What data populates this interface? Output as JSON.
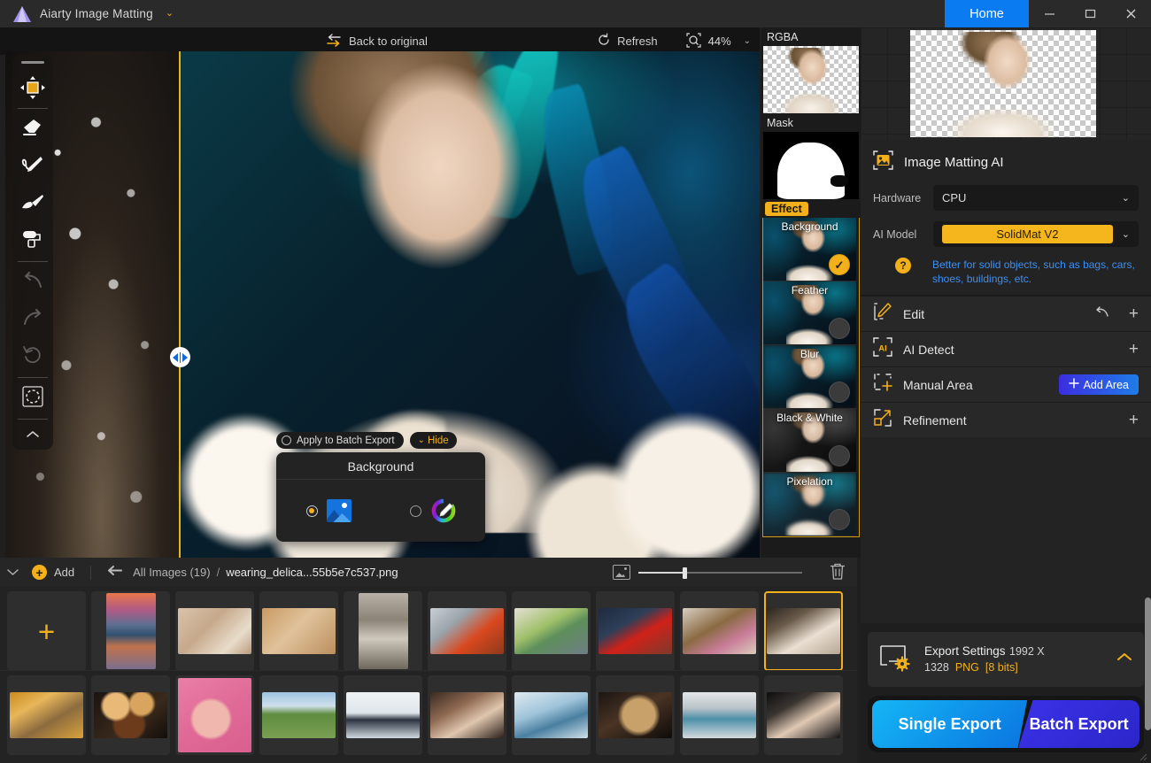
{
  "titlebar": {
    "app_name": "Aiarty Image Matting",
    "dropdown_caret": "⌄",
    "home_label": "Home",
    "minimize": "—",
    "maximize": "▢",
    "close": "✕"
  },
  "canvas_toolbar": {
    "back_to_original": "Back to original",
    "refresh": "Refresh",
    "zoom_level": "44%",
    "zoom_caret": "⌄"
  },
  "left_tools": [
    {
      "name": "move-tool",
      "label": "Move",
      "selected": true
    },
    {
      "name": "eraser-tool",
      "label": "Eraser",
      "selected": false
    },
    {
      "name": "restore-pen-tool",
      "label": "Restore",
      "selected": false
    },
    {
      "name": "brush-tool",
      "label": "Brush",
      "selected": false
    },
    {
      "name": "roller-tool",
      "label": "Roller",
      "selected": false
    },
    {
      "name": "undo-tool",
      "label": "Undo",
      "selected": false
    },
    {
      "name": "redo-tool",
      "label": "Redo",
      "selected": false
    },
    {
      "name": "reset-tool",
      "label": "Reset",
      "selected": false
    },
    {
      "name": "marquee-tool",
      "label": "Select Area",
      "selected": false
    }
  ],
  "background_popup": {
    "apply_to_batch_label": "Apply to Batch Export",
    "hide_label": "Hide",
    "hide_caret": "⌄⌄",
    "title": "Background",
    "option_image_selected": true,
    "option_color_selected": false
  },
  "preview_column": {
    "rgba_label": "RGBA",
    "mask_label": "Mask",
    "effect_label": "Effect",
    "effects": [
      {
        "label": "Background",
        "active": true
      },
      {
        "label": "Feather",
        "active": false
      },
      {
        "label": "Blur",
        "active": false
      },
      {
        "label": "Black & White",
        "active": false
      },
      {
        "label": "Pixelation",
        "active": false
      }
    ]
  },
  "right_panel": {
    "section_title": "Image Matting AI",
    "hardware_label": "Hardware",
    "hardware_value": "CPU",
    "ai_model_label": "AI Model",
    "ai_model_value": "SolidMat  V2",
    "help_glyph": "?",
    "model_hint": "Better for solid objects, such as bags, cars, shoes, buildings, etc.",
    "hint_color": "#3e8ff5",
    "accent_color": "#f2b01b",
    "rows": [
      {
        "label": "Edit",
        "icon": "edit-icon",
        "has_undo": true,
        "action": "plus"
      },
      {
        "label": "AI Detect",
        "icon": "ai-detect-icon",
        "has_undo": false,
        "action": "plus"
      },
      {
        "label": "Manual Area",
        "icon": "manual-area-icon",
        "has_undo": false,
        "action": "button",
        "button_label": "Add Area"
      },
      {
        "label": "Refinement",
        "icon": "refinement-icon",
        "has_undo": false,
        "action": "plus"
      }
    ]
  },
  "export": {
    "settings_title": "Export Settings",
    "dimensions": "1992 X 1328",
    "format": "PNG",
    "bits": "[8 bits]",
    "collapse_caret": "⌃",
    "single_export_label": "Single Export",
    "batch_export_label": "Batch Export"
  },
  "file_bar": {
    "collapse_caret": "⌄",
    "add_label": "Add",
    "back_arrow": "⬅",
    "breadcrumb_all": "All Images (19)",
    "breadcrumb_sep": "/",
    "breadcrumb_file": "wearing_delica...55b5e7c537.png",
    "trash_icon": "trash-icon"
  },
  "thumbnails": {
    "row1": [
      {
        "name": "add-thumbnail-cell",
        "art": "",
        "shape": "",
        "selected": false,
        "is_add": true
      },
      {
        "name": "thumb-car-sunset",
        "art": "a-car",
        "shape": "tall",
        "selected": false
      },
      {
        "name": "thumb-blonde-woman",
        "art": "a-blonde",
        "shape": "",
        "selected": false
      },
      {
        "name": "thumb-bride",
        "art": "a-bride",
        "shape": "",
        "selected": false
      },
      {
        "name": "thumb-skateboarder",
        "art": "a-skater",
        "shape": "tall",
        "selected": false
      },
      {
        "name": "thumb-red-coat-woman",
        "art": "a-redcoat",
        "shape": "",
        "selected": false
      },
      {
        "name": "thumb-green-van",
        "art": "a-van",
        "shape": "",
        "selected": false
      },
      {
        "name": "thumb-red-sports-car",
        "art": "a-redcar",
        "shape": "",
        "selected": false
      },
      {
        "name": "thumb-bottle-flowers",
        "art": "a-bottle",
        "shape": "",
        "selected": false
      },
      {
        "name": "thumb-current-subject",
        "art": "a-subject",
        "shape": "",
        "selected": true
      }
    ],
    "row2": [
      {
        "name": "thumb-tunnel",
        "art": "a-tunnel",
        "shape": "",
        "selected": false
      },
      {
        "name": "thumb-bokeh-drink",
        "art": "a-bokeh",
        "shape": "",
        "selected": false
      },
      {
        "name": "thumb-donuts",
        "art": "a-donut",
        "shape": "square",
        "selected": false
      },
      {
        "name": "thumb-field-dog",
        "art": "a-field",
        "shape": "",
        "selected": false
      },
      {
        "name": "thumb-jumping-people",
        "art": "a-jump",
        "shape": "",
        "selected": false
      },
      {
        "name": "thumb-portrait-woman",
        "art": "a-portrait",
        "shape": "",
        "selected": false
      },
      {
        "name": "thumb-perfume-ice",
        "art": "a-perfume",
        "shape": "",
        "selected": false
      },
      {
        "name": "thumb-watch-hand",
        "art": "a-watch",
        "shape": "",
        "selected": false
      },
      {
        "name": "thumb-street-can",
        "art": "a-street",
        "shape": "",
        "selected": false
      },
      {
        "name": "thumb-model-earrings",
        "art": "a-model",
        "shape": "",
        "selected": false
      }
    ]
  }
}
